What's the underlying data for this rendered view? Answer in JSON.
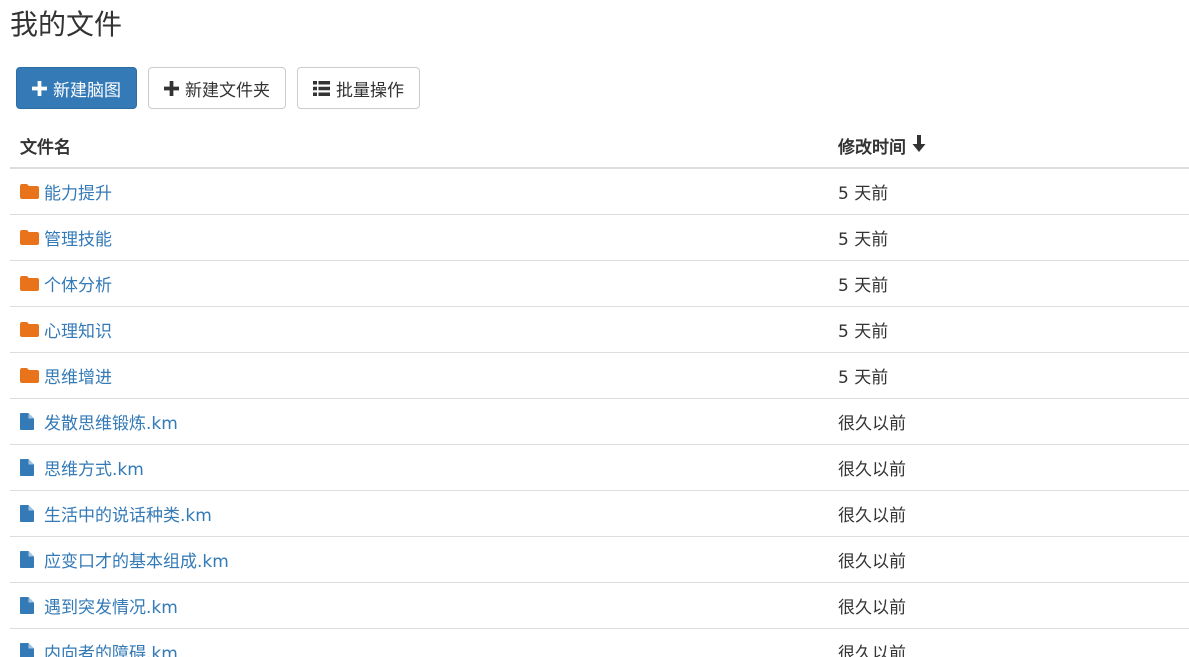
{
  "page": {
    "title": "我的文件"
  },
  "toolbar": {
    "new_mindmap_label": "新建脑图",
    "new_folder_label": "新建文件夹",
    "batch_label": "批量操作"
  },
  "table": {
    "columns": {
      "name": "文件名",
      "modified": "修改时间"
    },
    "rows": [
      {
        "type": "folder",
        "name": "能力提升",
        "modified": "5 天前"
      },
      {
        "type": "folder",
        "name": "管理技能",
        "modified": "5 天前"
      },
      {
        "type": "folder",
        "name": "个体分析",
        "modified": "5 天前"
      },
      {
        "type": "folder",
        "name": "心理知识",
        "modified": "5 天前"
      },
      {
        "type": "folder",
        "name": "思维增进",
        "modified": "5 天前"
      },
      {
        "type": "file",
        "name": "发散思维锻炼.km",
        "modified": "很久以前"
      },
      {
        "type": "file",
        "name": "思维方式.km",
        "modified": "很久以前"
      },
      {
        "type": "file",
        "name": "生活中的说话种类.km",
        "modified": "很久以前"
      },
      {
        "type": "file",
        "name": "应变口才的基本组成.km",
        "modified": "很久以前"
      },
      {
        "type": "file",
        "name": "遇到突发情况.km",
        "modified": "很久以前"
      },
      {
        "type": "file",
        "name": "内向者的障碍.km",
        "modified": "很久以前"
      }
    ]
  },
  "colors": {
    "folder_icon": "#e8731b",
    "file_icon": "#337ab7",
    "link": "#337ab7",
    "primary_button": "#337ab7"
  },
  "icons": {
    "new_mindmap": "plus-icon",
    "new_folder": "plus-icon",
    "batch": "list-icon",
    "sort": "arrow-down-icon",
    "folder": "folder-icon",
    "file": "file-icon"
  }
}
